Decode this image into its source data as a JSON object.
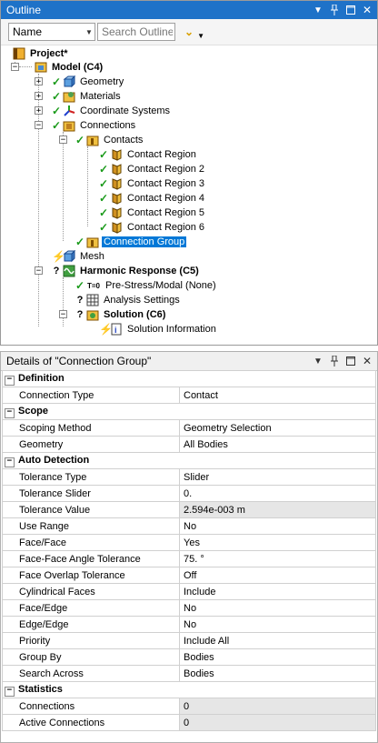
{
  "outline": {
    "title": "Outline",
    "filter_value": "Name",
    "search_placeholder": "Search Outline",
    "tree": {
      "project": "Project*",
      "model": "Model (C4)",
      "geometry": "Geometry",
      "materials": "Materials",
      "coordinate_systems": "Coordinate Systems",
      "connections": "Connections",
      "contacts": "Contacts",
      "contact_regions": [
        "Contact Region",
        "Contact Region 2",
        "Contact Region 3",
        "Contact Region 4",
        "Contact Region 5",
        "Contact Region 6"
      ],
      "connection_group": "Connection Group",
      "mesh": "Mesh",
      "harmonic": "Harmonic Response (C5)",
      "prestress": "Pre-Stress/Modal (None)",
      "t0": "T=0",
      "analysis_settings": "Analysis Settings",
      "solution": "Solution (C6)",
      "solution_info": "Solution Information"
    }
  },
  "details": {
    "title": "Details of \"Connection Group\"",
    "sections": {
      "definition": "Definition",
      "scope": "Scope",
      "auto_detection": "Auto Detection",
      "statistics": "Statistics"
    },
    "rows": {
      "connection_type": [
        "Connection Type",
        "Contact"
      ],
      "scoping_method": [
        "Scoping Method",
        "Geometry Selection"
      ],
      "geometry": [
        "Geometry",
        "All Bodies"
      ],
      "tolerance_type": [
        "Tolerance Type",
        "Slider"
      ],
      "tolerance_slider": [
        "Tolerance Slider",
        "0."
      ],
      "tolerance_value": [
        "Tolerance Value",
        "2.594e-003 m"
      ],
      "use_range": [
        "Use Range",
        "No"
      ],
      "face_face": [
        "Face/Face",
        "Yes"
      ],
      "face_angle": [
        "Face-Face Angle Tolerance",
        "75. °"
      ],
      "face_overlap": [
        "Face Overlap Tolerance",
        "Off"
      ],
      "cylindrical": [
        "Cylindrical Faces",
        "Include"
      ],
      "face_edge": [
        "Face/Edge",
        "No"
      ],
      "edge_edge": [
        "Edge/Edge",
        "No"
      ],
      "priority": [
        "Priority",
        "Include All"
      ],
      "group_by": [
        "Group By",
        "Bodies"
      ],
      "search_across": [
        "Search Across",
        "Bodies"
      ],
      "connections": [
        "Connections",
        "0"
      ],
      "active_connections": [
        "Active Connections",
        "0"
      ]
    }
  },
  "colors": {
    "titlebar": "#1e72c8",
    "selection": "#0078d7",
    "check": "#1a9a1a"
  }
}
